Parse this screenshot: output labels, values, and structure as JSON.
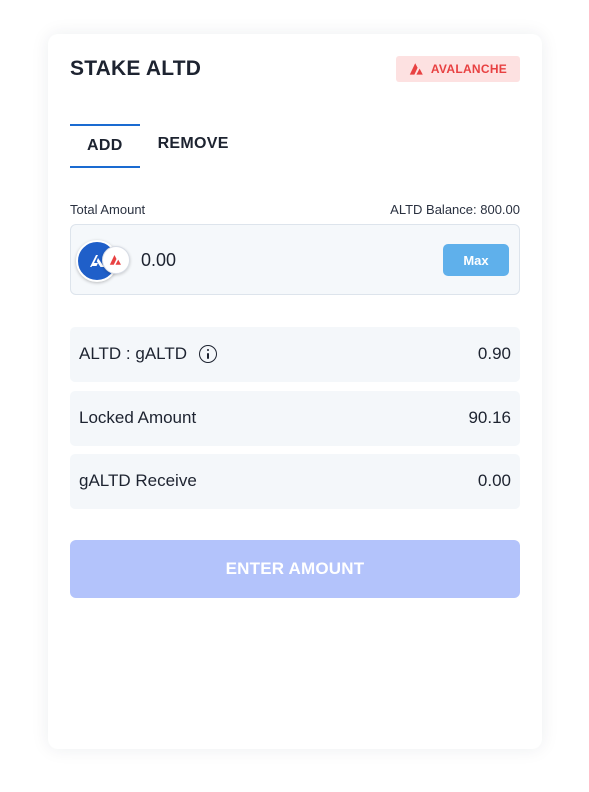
{
  "header": {
    "title": "STAKE ALTD",
    "chain_badge": {
      "label": "AVALANCHE",
      "icon": "avalanche-icon",
      "color": "#e84142",
      "background": "#fde1e1"
    }
  },
  "tabs": [
    {
      "label": "ADD",
      "active": true
    },
    {
      "label": "REMOVE",
      "active": false
    }
  ],
  "amount": {
    "label": "Total Amount",
    "balance_text": "ALTD Balance: 800.00",
    "value": "0.00",
    "token_icon": "altd-token-icon",
    "chain_icon": "avalanche-icon",
    "max_label": "Max"
  },
  "info_rows": [
    {
      "label": "ALTD : gALTD",
      "value": "0.90",
      "has_info_icon": true
    },
    {
      "label": "Locked Amount",
      "value": "90.16"
    },
    {
      "label": "gALTD Receive",
      "value": "0.00"
    }
  ],
  "submit": {
    "label": "ENTER AMOUNT",
    "disabled": true
  },
  "colors": {
    "accent": "#1a6bd1",
    "max_button": "#5fb0eb",
    "submit_disabled": "#b3c3fb",
    "row_background": "#f4f7fa"
  }
}
